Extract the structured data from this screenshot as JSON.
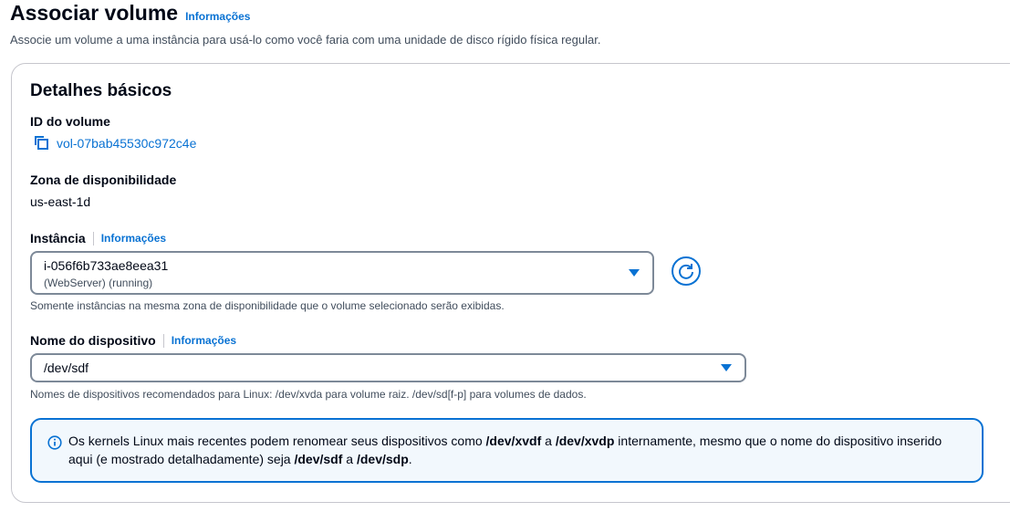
{
  "header": {
    "title": "Associar volume",
    "info_link": "Informações",
    "description": "Associe um volume a uma instância para usá-lo como você faria com uma unidade de disco rígido física regular."
  },
  "section": {
    "title": "Detalhes básicos",
    "volume_id_label": "ID do volume",
    "volume_id_value": "vol-07bab45530c972c4e",
    "az_label": "Zona de disponibilidade",
    "az_value": "us-east-1d",
    "instance_label": "Instância",
    "instance_info": "Informações",
    "instance_value": "i-056f6b733ae8eea31",
    "instance_sub": "(WebServer) (running)",
    "instance_hint": "Somente instâncias na mesma zona de disponibilidade que o volume selecionado serão exibidas.",
    "device_label": "Nome do dispositivo",
    "device_info": "Informações",
    "device_value": "/dev/sdf",
    "device_hint": "Nomes de dispositivos recomendados para Linux: /dev/xvda para volume raiz. /dev/sd[f-p] para volumes de dados."
  },
  "alert": {
    "part1": "Os kernels Linux mais recentes podem renomear seus dispositivos como ",
    "bold1": "/dev/xvdf",
    "part2": " a ",
    "bold2": "/dev/xvdp",
    "part3": " internamente, mesmo que o nome do dispositivo inserido aqui (e mostrado detalhadamente) seja ",
    "bold3": "/dev/sdf",
    "part4": " a ",
    "bold4": "/dev/sdp",
    "part5": "."
  },
  "colors": {
    "link": "#0972d3",
    "alert_bg": "#f2f8fd",
    "border": "#7d8998"
  },
  "icons": [
    "copy-icon",
    "caret-down-icon",
    "refresh-icon",
    "info-icon"
  ]
}
